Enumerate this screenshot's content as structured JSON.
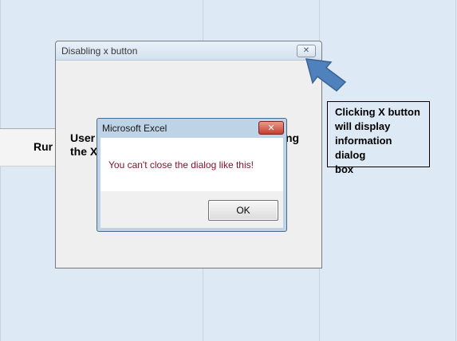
{
  "userform": {
    "title": "Disabling x button",
    "close_glyph": "✕",
    "label_line1": "User",
    "label_line2": "the X",
    "label_tail": "ng"
  },
  "sheet": {
    "run_text": "Rur"
  },
  "msgbox": {
    "title": "Microsoft Excel",
    "close_glyph": "✕",
    "message": "You can't close the dialog like this!",
    "ok_label": "OK"
  },
  "callout": {
    "text": "Clicking X button\nwill display\ninformation dialog\n box"
  },
  "colors": {
    "arrow_fill": "#4f81bd",
    "message_text": "#7a1428",
    "close_red": "#c4402e"
  },
  "icons": {
    "arrow": "arrow-pointer-icon",
    "userform_close": "close-icon",
    "msgbox_close": "close-icon"
  }
}
